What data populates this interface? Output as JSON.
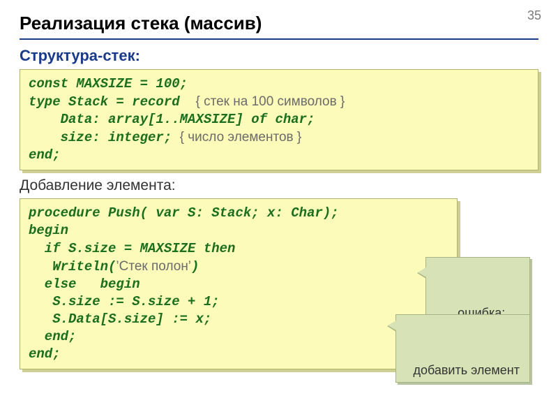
{
  "slide_number": "35",
  "title": "Реализация стека (массив)",
  "section1": "Структура-стек:",
  "section2": "Добавление элемента:",
  "code1": {
    "l1a": "const MAXSIZE = 100;",
    "l2a": "type Stack = record",
    "l2b": "{ стек на 100 символов }",
    "l3a": "    Data: array[1..MAXSIZE] of char;",
    "l4a": "    size: integer;",
    "l4b": "{ число элементов }",
    "l5a": "end;"
  },
  "code2": {
    "l1": "procedure Push( var S: Stack; x: Char);",
    "l2": "begin",
    "l3": "  if S.size = MAXSIZE then",
    "l4a": "   Writeln(",
    "l4b": "’Стек полон’",
    "l4c": ")",
    "l5": "  else   begin",
    "l6": "   S.size := S.size + 1;",
    "l7": "   S.Data[S.size] := x;",
    "l8": "  end;",
    "l9": "end;"
  },
  "callout1": "ошибка:\nпереполнение\nстека",
  "callout2": "добавить элемент"
}
